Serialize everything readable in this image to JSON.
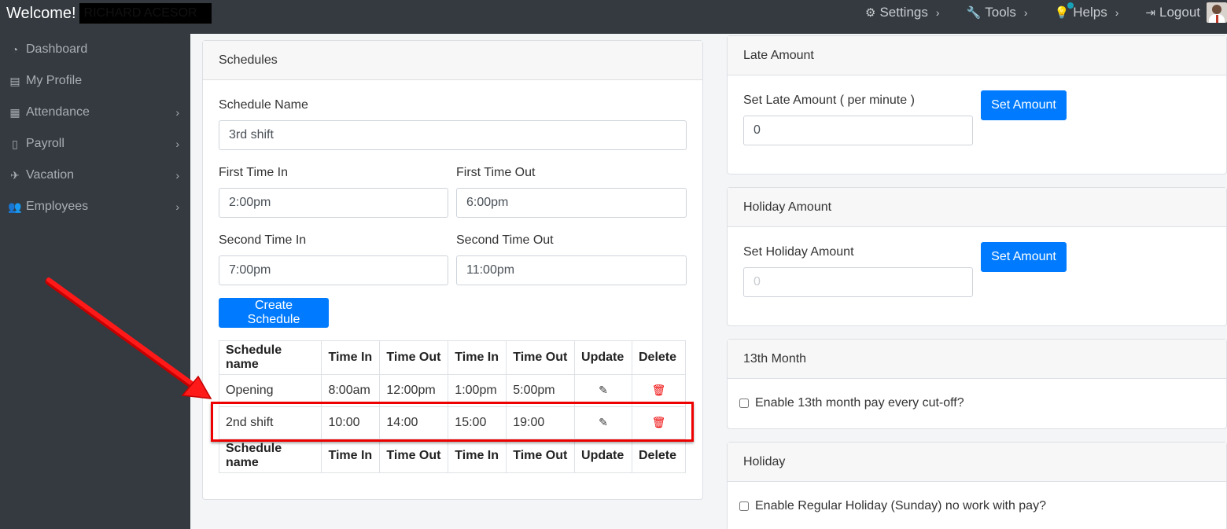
{
  "topbar": {
    "welcome": "Welcome!",
    "username": "RICHARD ACESOR",
    "nav": [
      {
        "label": "Settings",
        "icon": "gears-icon"
      },
      {
        "label": "Tools",
        "icon": "wrench-icon"
      },
      {
        "label": "Helps",
        "icon": "lightbulb-icon"
      },
      {
        "label": "Logout",
        "icon": "logout-icon"
      }
    ]
  },
  "sidebar": {
    "items": [
      {
        "label": "Dashboard",
        "icon": "dashboard-icon"
      },
      {
        "label": "My Profile",
        "icon": "id-card-icon"
      },
      {
        "label": "Attendance",
        "icon": "calendar-icon"
      },
      {
        "label": "Payroll",
        "icon": "document-icon"
      },
      {
        "label": "Vacation",
        "icon": "plane-icon"
      },
      {
        "label": "Employees",
        "icon": "users-icon"
      }
    ]
  },
  "schedules": {
    "title": "Schedules",
    "schedule_name_label": "Schedule Name",
    "schedule_name_value": "3rd shift",
    "first_time_in_label": "First Time In",
    "first_time_in_value": "2:00pm",
    "first_time_out_label": "First Time Out",
    "first_time_out_value": "6:00pm",
    "second_time_in_label": "Second Time In",
    "second_time_in_value": "7:00pm",
    "second_time_out_label": "Second Time Out",
    "second_time_out_value": "11:00pm",
    "create_button": "Create Schedule",
    "table": {
      "headers": [
        "Schedule name",
        "Time In",
        "Time Out",
        "Time In",
        "Time Out",
        "Update",
        "Delete"
      ],
      "rows": [
        {
          "name": "Opening",
          "in1": "8:00am",
          "out1": "12:00pm",
          "in2": "1:00pm",
          "out2": "5:00pm"
        },
        {
          "name": "2nd shift",
          "in1": "10:00",
          "out1": "14:00",
          "in2": "15:00",
          "out2": "19:00"
        }
      ]
    }
  },
  "late_amount": {
    "title": "Late Amount",
    "label": "Set Late Amount ( per minute )",
    "value": "0",
    "button": "Set Amount"
  },
  "holiday_amount": {
    "title": "Holiday Amount",
    "label": "Set Holiday Amount",
    "placeholder": "0",
    "button": "Set Amount"
  },
  "thirteenth_month": {
    "title": "13th Month",
    "checkbox_label": "Enable 13th month pay every cut-off?"
  },
  "holiday": {
    "title": "Holiday",
    "checkbox_label": "Enable Regular Holiday (Sunday) no work with pay?"
  },
  "colors": {
    "primary": "#007bff",
    "sidebar_bg": "#343a40",
    "annotation": "#ee0000",
    "delete": "#ee0000"
  }
}
